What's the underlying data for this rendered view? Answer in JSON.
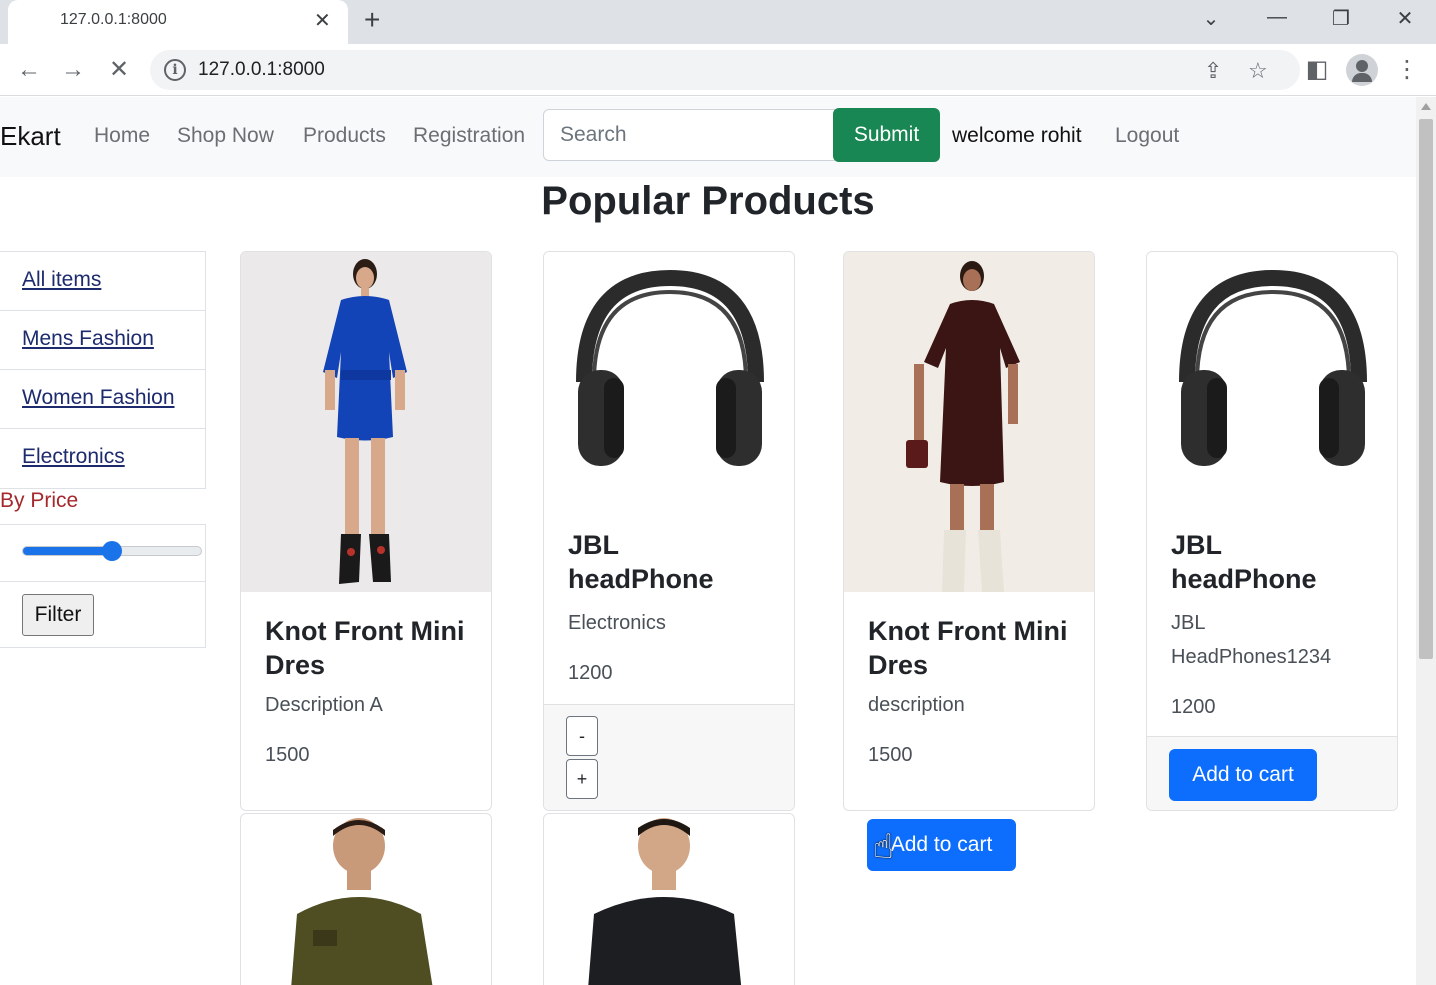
{
  "browser": {
    "tab_title": "127.0.0.1:8000",
    "tab_close": "✕",
    "new_tab": "+",
    "url": "127.0.0.1:8000",
    "info_glyph": "i",
    "window_buttons": [
      "⌄",
      "—",
      "❐",
      "✕"
    ],
    "toolbar_glyphs": {
      "back": "←",
      "forward": "→",
      "stop": "✕",
      "share": "⇪",
      "star": "☆",
      "sidepanel": "◧",
      "menu": "⋮"
    },
    "icons": [
      "back-icon",
      "forward-icon",
      "stop-loading-icon",
      "info-icon",
      "share-icon",
      "star-icon",
      "side-panel-icon",
      "profile-icon",
      "menu-icon"
    ]
  },
  "navbar": {
    "brand": "Ekart",
    "links": [
      "Home",
      "Shop Now",
      "Products",
      "Registration"
    ],
    "search_placeholder": "Search",
    "submit_label": "Submit",
    "welcome": "welcome rohit",
    "logout": "Logout"
  },
  "main": {
    "heading": "Popular Products"
  },
  "sidebar": {
    "items": [
      "All items",
      "Mens Fashion",
      "Women Fashion",
      "Electronics"
    ],
    "price_label": "By Price",
    "slider_value_fraction": 0.5,
    "filter_label": "Filter"
  },
  "products": [
    {
      "title": "Knot Front Mini Dres",
      "desc": "Description A",
      "price": "1500",
      "image": "blue-dress-model"
    },
    {
      "title": "JBL headPhone",
      "desc": "Electronics",
      "price": "1200",
      "image": "black-headphones",
      "qty_minus": "-",
      "qty_plus": "+"
    },
    {
      "title": "Knot Front Mini Dres",
      "desc": "description",
      "price": "1500",
      "image": "maroon-dress-model",
      "button": "Add to cart"
    },
    {
      "title": "JBL headPhone",
      "desc_line1": "JBL",
      "desc_line2": "HeadPhones1234",
      "price": "1200",
      "image": "black-headphones",
      "button": "Add to cart"
    }
  ],
  "second_row": [
    {
      "image": "man-olive-shirt"
    },
    {
      "image": "man-black-shirt"
    }
  ],
  "colors": {
    "submit_green": "#198754",
    "primary_blue": "#0d6efd",
    "price_label_red": "#a5282d",
    "sidebar_link": "#1d2b6e"
  }
}
